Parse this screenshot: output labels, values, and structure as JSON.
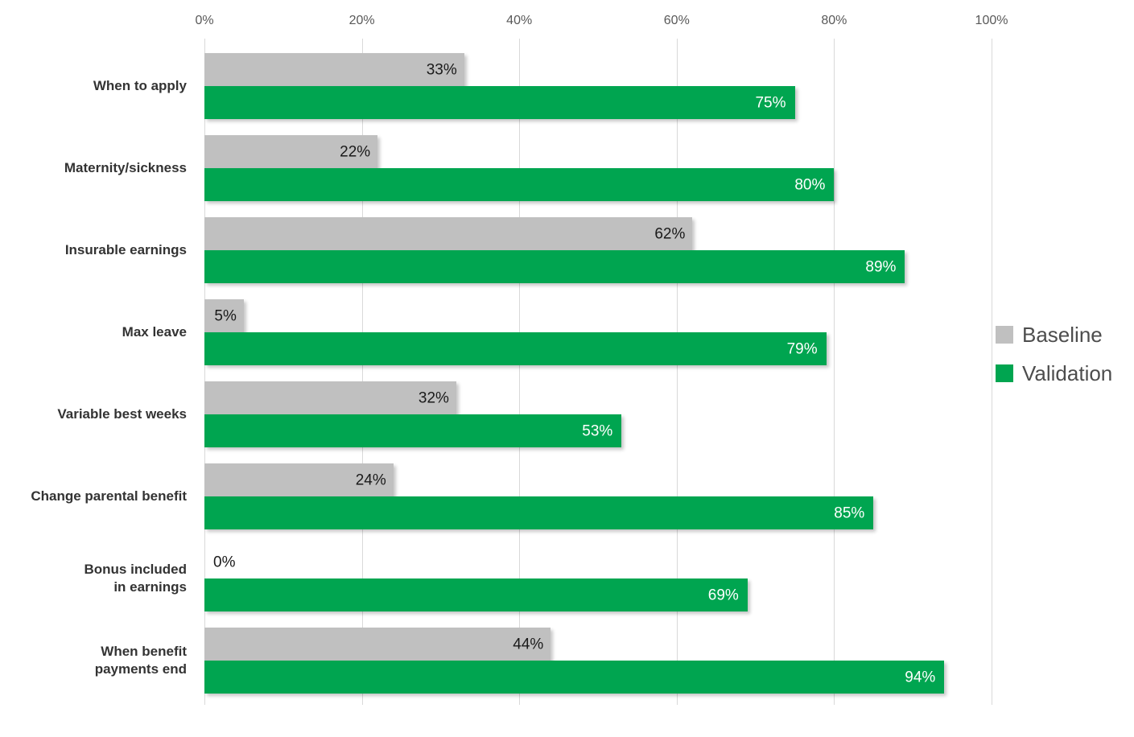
{
  "chart_data": {
    "type": "bar",
    "orientation": "horizontal",
    "title": "",
    "xlabel": "",
    "ylabel": "",
    "xlim": [
      0,
      100
    ],
    "grid": true,
    "grid_axis": "x",
    "legend_position": "right",
    "tick_labels": [
      "0%",
      "20%",
      "40%",
      "60%",
      "80%",
      "100%"
    ],
    "ticks": [
      0,
      20,
      40,
      60,
      80,
      100
    ],
    "categories": [
      "When to apply",
      "Maternity/sickness",
      "Insurable earnings",
      "Max leave",
      "Variable best weeks",
      "Change parental benefit",
      "Bonus included\nin earnings",
      "When benefit\npayments end"
    ],
    "category_lines": [
      [
        "When to apply"
      ],
      [
        "Maternity/sickness"
      ],
      [
        "Insurable earnings"
      ],
      [
        "Max leave"
      ],
      [
        "Variable best weeks"
      ],
      [
        "Change parental benefit"
      ],
      [
        "Bonus included",
        "in earnings"
      ],
      [
        "When benefit",
        "payments end"
      ]
    ],
    "series": [
      {
        "name": "Baseline",
        "color": "#c0c0c0",
        "values": [
          33,
          22,
          62,
          5,
          32,
          24,
          0,
          44
        ],
        "labels": [
          "33%",
          "22%",
          "62%",
          "5%",
          "32%",
          "24%",
          "0%",
          "44%"
        ]
      },
      {
        "name": "Validation",
        "color": "#00a550",
        "values": [
          75,
          80,
          89,
          79,
          53,
          85,
          69,
          94
        ],
        "labels": [
          "75%",
          "80%",
          "89%",
          "79%",
          "53%",
          "85%",
          "69%",
          "94%"
        ]
      }
    ]
  },
  "legend": {
    "items": [
      {
        "label": "Baseline",
        "color": "#c0c0c0"
      },
      {
        "label": "Validation",
        "color": "#00a550"
      }
    ]
  },
  "colors": {
    "baseline": "#c0c0c0",
    "validation": "#00a550",
    "gridline": "#d9d9d9",
    "tick_text": "#595959",
    "category_text": "#333333",
    "legend_text": "#4d4d4d",
    "background": "#ffffff"
  }
}
